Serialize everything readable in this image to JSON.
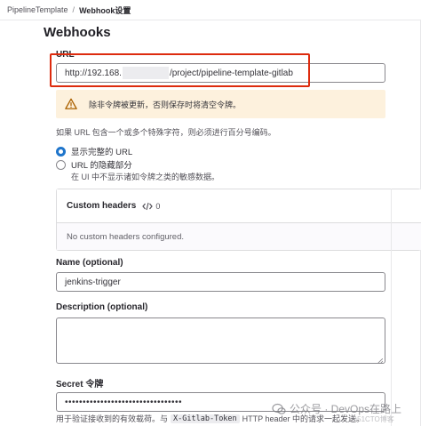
{
  "breadcrumb": {
    "parent": "PipelineTemplate",
    "separator": "/",
    "current": "Webhook设置"
  },
  "page": {
    "title": "Webhooks"
  },
  "url": {
    "label": "URL",
    "value_prefix": "http://192.168.",
    "value_suffix": "/project/pipeline-template-gitlab"
  },
  "alert": {
    "text": "除非令牌被更新，否则保存时将清空令牌。",
    "icon": "warning-icon",
    "color": "#fdf1dd"
  },
  "url_help": "如果 URL 包含一个或多个特殊字符，则必须进行百分号编码。",
  "radio_options": [
    {
      "label": "显示完整的 URL",
      "checked": true
    },
    {
      "label": "URL 的隐藏部分",
      "checked": false,
      "description": "在 UI 中不显示诸如令牌之类的敏感数据。"
    }
  ],
  "custom_headers": {
    "title": "Custom headers",
    "count": "0",
    "empty_text": "No custom headers configured."
  },
  "name": {
    "label": "Name (optional)",
    "value": "jenkins-trigger"
  },
  "description": {
    "label": "Description (optional)",
    "value": ""
  },
  "secret": {
    "label": "Secret 令牌",
    "value": "•••••••••••••••••••••••••••••••••",
    "help_before": "用于验证接收到的有效载荷。与",
    "help_code": "X-Gitlab-Token",
    "help_after": "HTTP header 中的请求一起发送。"
  },
  "watermark": {
    "text": "公众号 · DevOps在路上",
    "subtext": "@51CTO博客"
  },
  "colors": {
    "accent": "#1f75cb",
    "highlight": "#dd2b0e"
  }
}
